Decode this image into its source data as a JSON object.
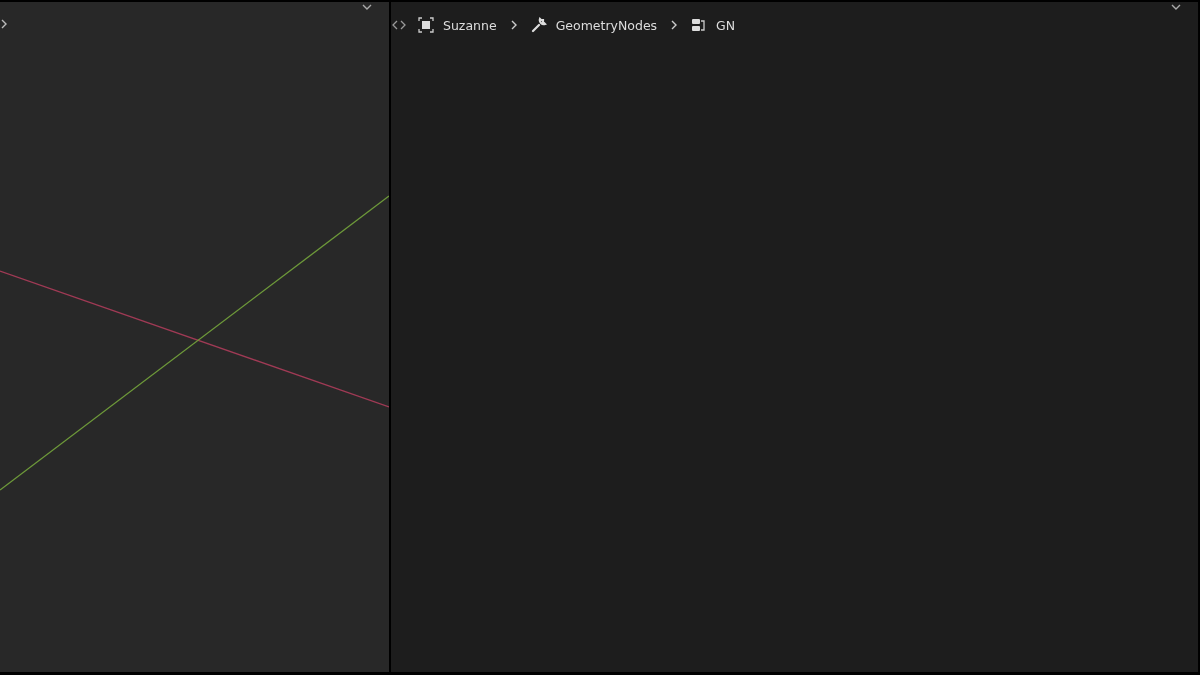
{
  "breadcrumb": [
    {
      "label": "Suzanne",
      "kind": "object"
    },
    {
      "label": "GeometryNodes",
      "kind": "modifier"
    },
    {
      "label": "GN",
      "kind": "node-tree"
    }
  ]
}
